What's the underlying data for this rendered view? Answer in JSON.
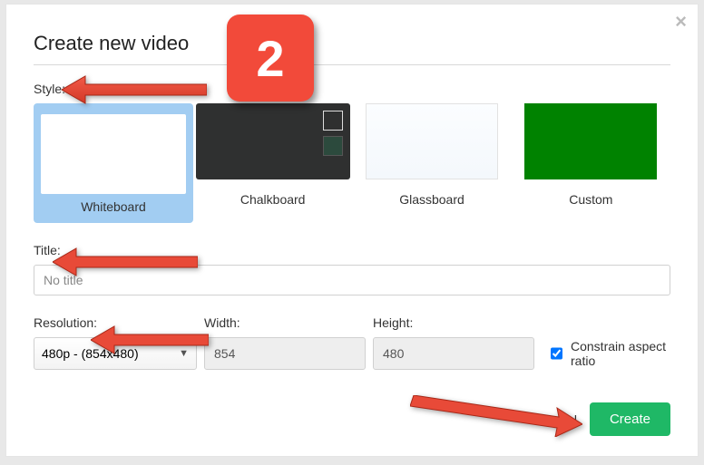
{
  "dialog": {
    "title": "Create new video",
    "close_symbol": "×"
  },
  "style": {
    "label": "Style:",
    "options": [
      {
        "name": "Whiteboard",
        "selected": true
      },
      {
        "name": "Chalkboard",
        "selected": false
      },
      {
        "name": "Glassboard",
        "selected": false
      },
      {
        "name": "Custom",
        "selected": false
      }
    ]
  },
  "title_field": {
    "label": "Title:",
    "placeholder": "No title",
    "value": ""
  },
  "resolution": {
    "label": "Resolution:",
    "select_value": "480p  -  (854x480)",
    "width_label": "Width:",
    "width_value": "854",
    "height_label": "Height:",
    "height_value": "480",
    "constrain_label": "Constrain aspect ratio",
    "constrain_checked": true
  },
  "footer": {
    "cancel_label": "Cancel",
    "create_label": "Create"
  },
  "annotation": {
    "step_number": "2"
  }
}
